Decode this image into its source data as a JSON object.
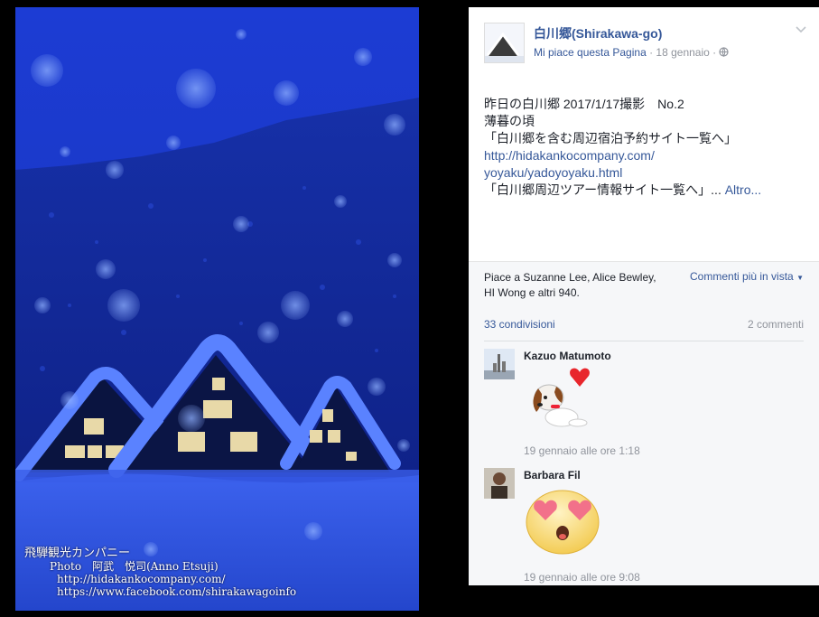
{
  "photo": {
    "credits": {
      "company": "飛騨観光カンパニー",
      "photo": "Photo　阿武　悦司(Anno Etsuji)",
      "site": "http://hidakankocompany.com/",
      "facebook": "https://www.facebook.com/shirakawagoinfo"
    }
  },
  "post": {
    "page_name": "白川郷(Shirakawa-go)",
    "like_page": "Mi piace questa Pagina",
    "separator": " · ",
    "date": "18 gennaio",
    "separator2": " · ",
    "lines": {
      "line1": "昨日の白川郷 2017/1/17撮影　No.2",
      "line2": "薄暮の頃",
      "line3": "「白川郷を含む周辺宿泊予約サイト一覧へ」",
      "link1": "http://hidakankocompany.com/",
      "link2": "yoyaku/yadoyoyaku.html",
      "line4": "「白川郷周辺ツアー情報サイト一覧へ」...",
      "more": " Altro..."
    }
  },
  "engagement": {
    "likes_text": "Piace a Suzanne Lee, Alice Bewley, HI Wong e altri 940.",
    "sort_label": "Commenti più in vista",
    "shares": "33 condivisioni",
    "comments": "2 commenti"
  },
  "comments": [
    {
      "author": "Kazuo Matumoto",
      "time": "19 gennaio alle ore 1:18",
      "sticker": "puppy-heart-sticker"
    },
    {
      "author": "Barbara Fil",
      "time": "19 gennaio alle ore 9:08",
      "sticker": "heart-eyes-emoji"
    }
  ],
  "colors": {
    "link": "#365899",
    "meta": "#90949c",
    "text": "#1d2129",
    "photo_blue": "#1a36c8"
  }
}
